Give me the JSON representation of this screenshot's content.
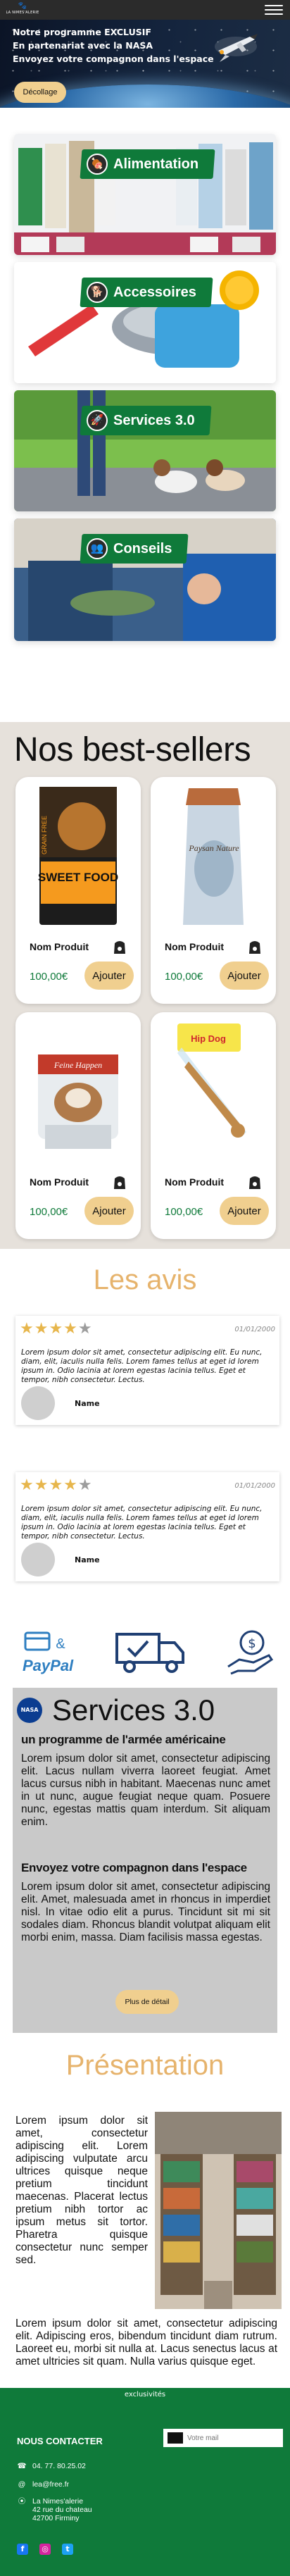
{
  "header": {
    "logo_text": "LA NIMES'ALERIE",
    "menu_icon": "hamburger-icon"
  },
  "hero": {
    "lines": [
      "Notre programme EXCLUSIF",
      "En partenariat avec la NASA",
      "Envoyez votre compagnon dans l'espace"
    ],
    "button": "Décollage"
  },
  "categories": [
    {
      "label": "Alimentation",
      "icon": "food-icon"
    },
    {
      "label": "Accessoires",
      "icon": "accessories-icon"
    },
    {
      "label": "Services 3.0",
      "icon": "rocket-icon"
    },
    {
      "label": "Conseils",
      "icon": "people-icon"
    }
  ],
  "best_sellers": {
    "title": "Nos best-sellers",
    "products": [
      {
        "name": "Nom Produit",
        "price": "100,00€",
        "button": "Ajouter",
        "image_text": "SWEET FOOD",
        "image_side_text": "GRAIN FREE"
      },
      {
        "name": "Nom Produit",
        "price": "100,00€",
        "button": "Ajouter",
        "image_text": "Paysan Nature"
      },
      {
        "name": "Nom Produit",
        "price": "100,00€",
        "button": "Ajouter",
        "image_text": "Feine Happen"
      },
      {
        "name": "Nom Produit",
        "price": "100,00€",
        "button": "Ajouter",
        "image_text": "Hip Dog"
      }
    ]
  },
  "reviews": {
    "title": "Les avis",
    "items": [
      {
        "stars": 4,
        "date": "01/01/2000",
        "text": "Lorem ipsum dolor sit amet, consectetur adipiscing elit. Eu nunc, diam, elit, iaculis nulla felis. Lorem fames tellus at eget id lorem ipsum in. Odio lacinia at lorem egestas lacinia tellus. Eget et tempor, nibh consectetur. Lectus.",
        "name": "Name"
      },
      {
        "stars": 4,
        "date": "01/01/2000",
        "text": "Lorem ipsum dolor sit amet, consectetur adipiscing elit. Eu nunc, diam, elit, iaculis nulla felis. Lorem fames tellus at eget id lorem ipsum in. Odio lacinia at lorem egestas lacinia tellus. Eget et tempor, nibh consectetur. Lectus.",
        "name": "Name"
      }
    ]
  },
  "trust": {
    "paypal_amp": "&",
    "paypal_label": "PayPal",
    "icons": [
      "card-icon",
      "delivery-truck-icon",
      "money-hand-icon"
    ]
  },
  "services": {
    "logo": "NASA",
    "title": "Services 3.0",
    "subtitle1": "un programme de l'armée américaine",
    "para1": "Lorem ipsum dolor sit amet, consectetur adipiscing elit. Lacus nullam viverra laoreet feugiat. Amet lacus cursus nibh in habitant. Maecenas nunc amet in ut nunc, augue feugiat neque quam. Posuere nunc, egestas mattis quam interdum. Sit aliquam enim.",
    "subtitle2": "Envoyez votre compagnon dans l'espace",
    "para2": "Lorem ipsum dolor sit amet, consectetur adipiscing elit. Amet, malesuada amet in rhoncus in imperdiet nisl. In vitae odio elit a purus. Tincidunt sit mi sit sodales diam. Rhoncus blandit volutpat aliquam elit morbi enim, massa. Diam facilisis massa egestas.",
    "button": "Plus de détail"
  },
  "presentation": {
    "title": "Présentation",
    "para1": "Lorem ipsum dolor sit amet, consectetur adipiscing elit. Lorem adipiscing vulputate arcu ultrices quisque neque pretium tincidunt maecenas. Placerat lectus pretium nibh tortor ac ipsum metus sit tortor. Pharetra quisque consectetur nunc semper sed.",
    "para2": "Lorem ipsum dolor sit amet, consectetur adipiscing elit. Adipiscing eros, bibendum tincidunt diam rutrum. Laoreet eu, morbi sit nulla at. Lacus senectus lacus at amet ultricies sit quam. Nulla varius quisque eget."
  },
  "footer": {
    "exclusivites": "exclusivités",
    "contact_title": "NOUS CONTACTER",
    "phone": "04. 77. 80.25.02",
    "email": "lea@free.fr",
    "address": [
      "La Nimes'alerie",
      "42 rue du chateau",
      "42700 Firminy"
    ],
    "email_placeholder": "Votre mail",
    "social": [
      "facebook-icon",
      "instagram-icon",
      "twitter-icon"
    ]
  },
  "colors": {
    "brand_green": "#0f7a3a",
    "accent_gold": "#f0cf8f",
    "title_gold": "#e6b36c",
    "beige_bg": "#e6e1db",
    "services_bg": "#c9c9c9"
  }
}
